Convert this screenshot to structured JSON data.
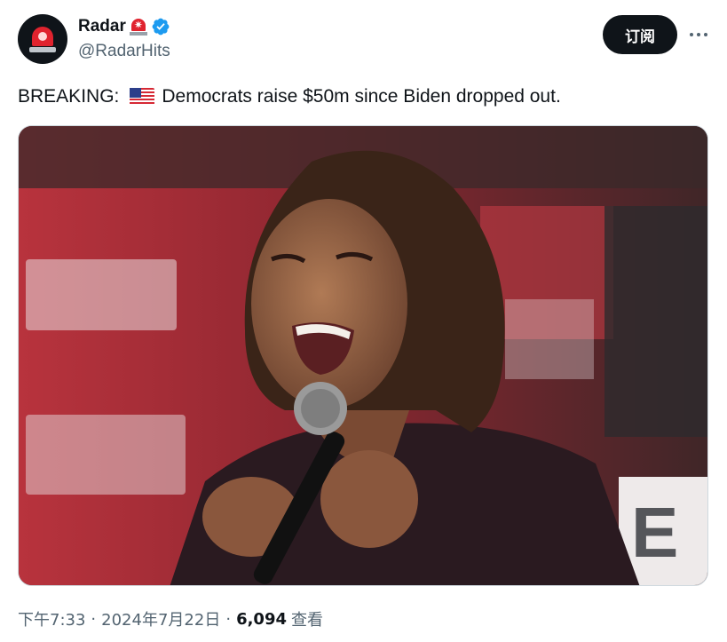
{
  "author": {
    "display_name": "Radar",
    "handle": "@RadarHits",
    "avatar_icon": "siren-icon",
    "name_emoji": "rotating-light-icon",
    "verified": true
  },
  "actions": {
    "subscribe_label": "订阅",
    "more_icon": "more-horizontal-icon"
  },
  "tweet": {
    "prefix": "BREAKING:",
    "flag_icon": "us-flag-icon",
    "body": "Democrats raise $50m since Biden dropped out."
  },
  "media": {
    "alt": ""
  },
  "footer": {
    "time": "下午7:33",
    "separator": "·",
    "date": "2024年7月22日",
    "views_count": "6,094",
    "views_label": "查看"
  },
  "colors": {
    "text": "#0f1419",
    "secondary": "#536471",
    "verified": "#1d9bf0",
    "button": "#0f1419"
  }
}
